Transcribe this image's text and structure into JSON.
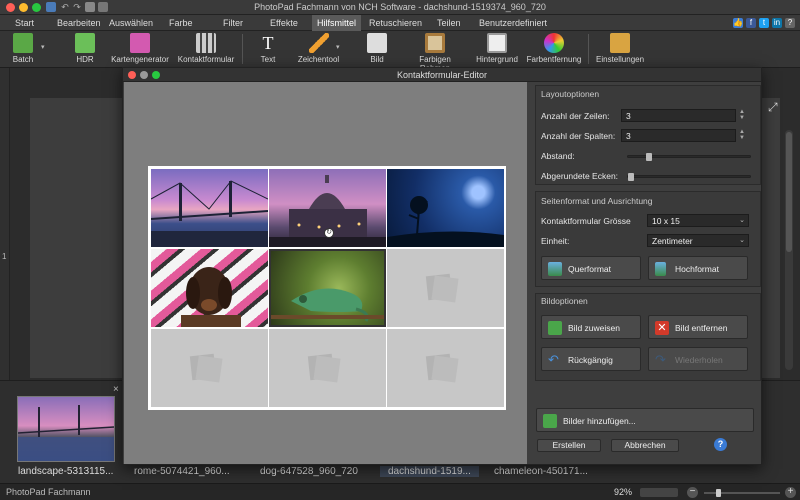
{
  "window": {
    "title": "PhotoPad Fachmann von NCH Software - dachshund-1519374_960_720"
  },
  "menu": {
    "items": [
      "Start",
      "Bearbeiten",
      "Auswählen",
      "Farbe",
      "Filter",
      "Effekte",
      "Hilfsmittel",
      "Retuschieren",
      "Teilen",
      "Benutzerdefiniert"
    ],
    "active": "Hilfsmittel"
  },
  "toolbar": {
    "items": [
      {
        "label": "Batch",
        "icon": "batch-icon"
      },
      {
        "label": "HDR",
        "icon": "hdr-icon"
      },
      {
        "label": "Kartengenerator",
        "icon": "card-generator-icon"
      },
      {
        "label": "Kontaktformular",
        "icon": "contact-sheet-icon"
      },
      {
        "label": "Text",
        "icon": "text-icon"
      },
      {
        "label": "Zeichentool",
        "icon": "pencil-icon"
      },
      {
        "label": "Bild",
        "icon": "image-icon"
      },
      {
        "label": "Farbigen Rahmen",
        "icon": "colored-frame-icon"
      },
      {
        "label": "Hintergrund",
        "icon": "background-icon"
      },
      {
        "label": "Farbentfernung",
        "icon": "color-removal-icon"
      },
      {
        "label": "Einstellungen",
        "icon": "settings-icon"
      }
    ]
  },
  "ruler": {
    "mark": "1"
  },
  "dialog": {
    "title": "Kontaktformular-Editor",
    "layout": {
      "heading": "Layoutoptionen",
      "rows_label": "Anzahl der Zeilen:",
      "rows_value": "3",
      "cols_label": "Anzahl der Spalten:",
      "cols_value": "3",
      "spacing_label": "Abstand:",
      "spacing_value": 0.15,
      "corners_label": "Abgerundete Ecken:",
      "corners_value": 0.0
    },
    "page": {
      "heading": "Seitenformat und Ausrichtung",
      "size_label": "Kontaktformular Grösse",
      "size_value": "10 x 15",
      "unit_label": "Einheit:",
      "unit_value": "Zentimeter",
      "landscape_label": "Querformat",
      "portrait_label": "Hochformat"
    },
    "image_options": {
      "heading": "Bildoptionen",
      "assign_label": "Bild zuweisen",
      "remove_label": "Bild entfernen",
      "undo_label": "Rückgängig",
      "redo_label": "Wiederholen"
    },
    "add_images_label": "Bilder hinzufügen...",
    "create_label": "Erstellen",
    "cancel_label": "Abbrechen",
    "help_label": "?"
  },
  "thumbnails": [
    "landscape-5313115...",
    "rome-5074421_960...",
    "dog-647528_960_720",
    "dachshund-1519...",
    "chameleon-450171..."
  ],
  "status": {
    "app": "PhotoPad Fachmann",
    "zoom": "92%"
  },
  "colors": {
    "accent": "#4a90d9",
    "active_menu": "#5a5a5a",
    "dialog_bg": "#3e3e3e"
  }
}
